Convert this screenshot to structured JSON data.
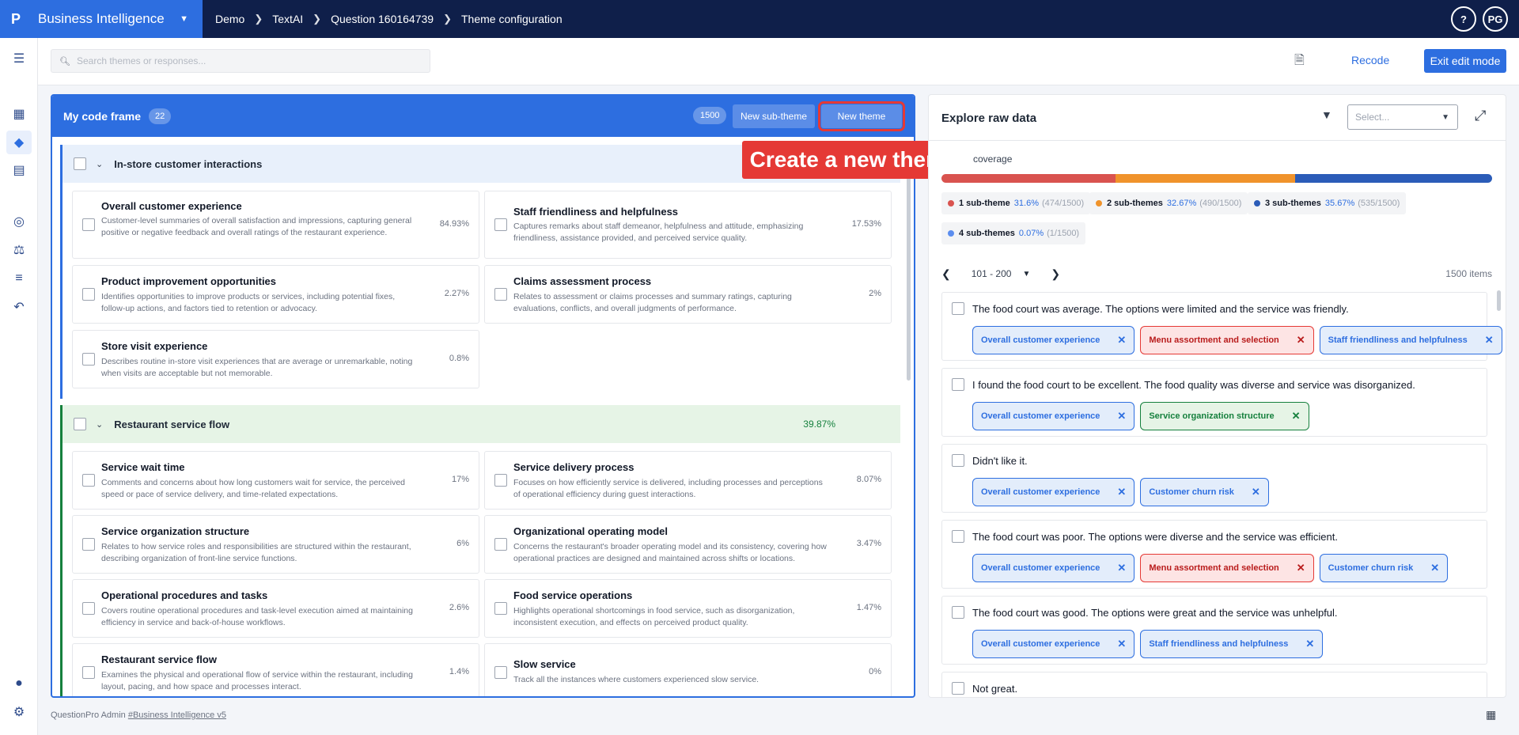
{
  "header": {
    "logo": "P",
    "app_name": "Business Intelligence",
    "breadcrumbs": [
      "Demo",
      "TextAI",
      "Question 160164739",
      "Theme configuration"
    ],
    "help": "?",
    "avatar": "PG"
  },
  "toolbar": {
    "search_placeholder": "Search themes or responses...",
    "recode_label": "Recode",
    "exit_label": "Exit edit mode"
  },
  "codeframe": {
    "title": "My code frame",
    "count": "22",
    "total": "1500",
    "new_sub_theme_label": "New sub-theme",
    "new_theme_label": "New theme",
    "sections": [
      {
        "title": "In-store customer interactions",
        "pct": "",
        "cards": [
          {
            "title": "Overall customer experience",
            "desc": "Customer-level summaries of overall satisfaction and impressions, capturing general positive or negative feedback and overall ratings of the restaurant experience.",
            "pct": "84.93%"
          },
          {
            "title": "Staff friendliness and helpfulness",
            "desc": "Captures remarks about staff demeanor, helpfulness and attitude, emphasizing friendliness, assistance provided, and perceived service quality.",
            "pct": "17.53%"
          },
          {
            "title": "Product improvement opportunities",
            "desc": "Identifies opportunities to improve products or services, including potential fixes, follow-up actions, and factors tied to retention or advocacy.",
            "pct": "2.27%"
          },
          {
            "title": "Claims assessment process",
            "desc": "Relates to assessment or claims processes and summary ratings, capturing evaluations, conflicts, and overall judgments of performance.",
            "pct": "2%"
          },
          {
            "title": "Store visit experience",
            "desc": "Describes routine in-store visit experiences that are average or unremarkable, noting when visits are acceptable but not memorable.",
            "pct": "0.8%"
          }
        ]
      },
      {
        "title": "Restaurant service flow",
        "pct": "39.87%",
        "cards": [
          {
            "title": "Service wait time",
            "desc": "Comments and concerns about how long customers wait for service, the perceived speed or pace of service delivery, and time-related expectations.",
            "pct": "17%"
          },
          {
            "title": "Service delivery process",
            "desc": "Focuses on how efficiently service is delivered, including processes and perceptions of operational efficiency during guest interactions.",
            "pct": "8.07%"
          },
          {
            "title": "Service organization structure",
            "desc": "Relates to how service roles and responsibilities are structured within the restaurant, describing organization of front-line service functions.",
            "pct": "6%"
          },
          {
            "title": "Organizational operating model",
            "desc": "Concerns the restaurant's broader operating model and its consistency, covering how operational practices are designed and maintained across shifts or locations.",
            "pct": "3.47%"
          },
          {
            "title": "Operational procedures and tasks",
            "desc": "Covers routine operational procedures and task-level execution aimed at maintaining efficiency in service and back-of-house workflows.",
            "pct": "2.6%"
          },
          {
            "title": "Food service operations",
            "desc": "Highlights operational shortcomings in food service, such as disorganization, inconsistent execution, and effects on perceived product quality.",
            "pct": "1.47%"
          },
          {
            "title": "Restaurant service flow",
            "desc": "Examines the physical and operational flow of service within the restaurant, including layout, pacing, and how space and processes interact.",
            "pct": "1.4%"
          },
          {
            "title": "Slow service",
            "desc": "Track all the instances where customers experienced slow service.",
            "pct": "0%"
          }
        ]
      }
    ]
  },
  "tooltip": {
    "text": "Create a new theme."
  },
  "explore": {
    "title": "Explore raw data",
    "select_placeholder": "Select...",
    "coverage_label": "coverage",
    "coverage": [
      {
        "label": "1 sub-theme",
        "pct": "31.6%",
        "count": "(474/1500)",
        "color": "#d9534f",
        "fraction": 0.316
      },
      {
        "label": "2 sub-themes",
        "pct": "32.67%",
        "count": "(490/1500)",
        "color": "#f0932b",
        "fraction": 0.3267
      },
      {
        "label": "3 sub-themes",
        "pct": "35.67%",
        "count": "(535/1500)",
        "color": "#2b5cb8",
        "fraction": 0.3567
      },
      {
        "label": "4 sub-themes",
        "pct": "0.07%",
        "count": "(1/1500)",
        "color": "#5b8def",
        "fraction": 0.0007
      }
    ],
    "pager_range": "101 - 200",
    "items_label": "1500 items",
    "responses": [
      {
        "text": "The food court was average. The options were limited and the service was friendly.",
        "tags": [
          {
            "label": "Overall customer experience",
            "color": "blue"
          },
          {
            "label": "Menu assortment and selection",
            "color": "red"
          },
          {
            "label": "Staff friendliness and helpfulness",
            "color": "blue"
          }
        ]
      },
      {
        "text": "I found the food court to be excellent. The food quality was diverse and service was disorganized.",
        "tags": [
          {
            "label": "Overall customer experience",
            "color": "blue"
          },
          {
            "label": "Service organization structure",
            "color": "green"
          }
        ]
      },
      {
        "text": "Didn't like it.",
        "tags": [
          {
            "label": "Overall customer experience",
            "color": "blue"
          },
          {
            "label": "Customer churn risk",
            "color": "blue"
          }
        ]
      },
      {
        "text": "The food court was poor. The options were diverse and the service was efficient.",
        "tags": [
          {
            "label": "Overall customer experience",
            "color": "blue"
          },
          {
            "label": "Menu assortment and selection",
            "color": "red"
          },
          {
            "label": "Customer churn risk",
            "color": "blue"
          }
        ]
      },
      {
        "text": "The food court was good. The options were great and the service was unhelpful.",
        "tags": [
          {
            "label": "Overall customer experience",
            "color": "blue"
          },
          {
            "label": "Staff friendliness and helpfulness",
            "color": "blue"
          }
        ]
      },
      {
        "text": "Not great.",
        "tags": []
      }
    ]
  },
  "footer": {
    "prefix": "QuestionPro Admin",
    "link": "#Business Intelligence v5"
  }
}
